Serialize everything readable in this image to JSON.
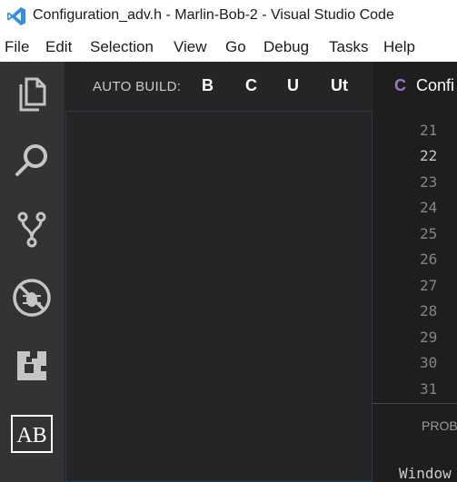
{
  "window": {
    "title": "Configuration_adv.h - Marlin-Bob-2 - Visual Studio Code"
  },
  "menu": [
    "File",
    "Edit",
    "Selection",
    "View",
    "Go",
    "Debug",
    "Tasks",
    "Help"
  ],
  "activity_bar": {
    "icons": [
      "files-icon",
      "search-icon",
      "source-control-icon",
      "debug-icon",
      "extensions-icon",
      "auto-build-icon"
    ],
    "ab_label": "AB"
  },
  "sidebar": {
    "title": "AUTO BUILD:",
    "buttons": [
      "B",
      "C",
      "U",
      "Ut"
    ]
  },
  "editor": {
    "tab": {
      "lang_icon": "C",
      "label": "Confi"
    },
    "line_numbers": [
      "21",
      "22",
      "23",
      "24",
      "25",
      "26",
      "27",
      "28",
      "29",
      "30",
      "31"
    ],
    "active_line": "22"
  },
  "panel": {
    "tab_label": "PROB",
    "output_text": "Window"
  },
  "colors": {
    "activity_bar": "#333333",
    "sidebar": "#252526",
    "editor": "#1e1e1e",
    "c_icon": "#a074c4"
  }
}
